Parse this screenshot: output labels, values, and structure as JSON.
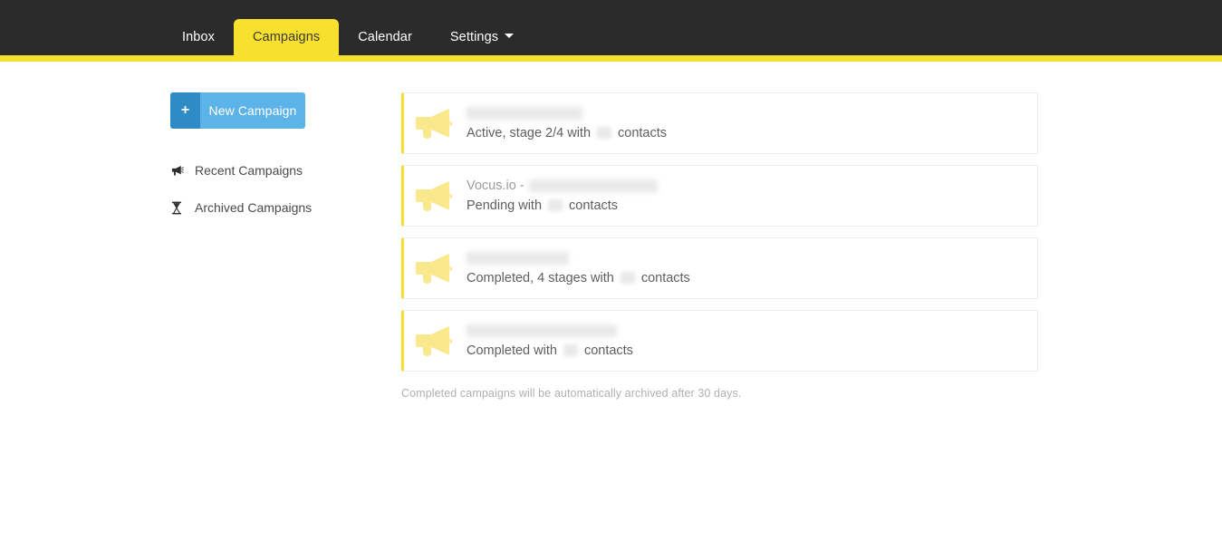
{
  "header": {
    "nav_items": [
      {
        "label": "Inbox",
        "active": false,
        "has_caret": false
      },
      {
        "label": "Campaigns",
        "active": true,
        "has_caret": false
      },
      {
        "label": "Calendar",
        "active": false,
        "has_caret": false
      },
      {
        "label": "Settings",
        "active": false,
        "has_caret": true
      }
    ],
    "accent_color": "#f5e02e",
    "background_color": "#2b2b2b"
  },
  "sidebar": {
    "new_campaign": {
      "plus_label": "+",
      "label": "New Campaign",
      "plus_color": "#2e8bc6",
      "button_color": "#5cb3e8"
    },
    "links": [
      {
        "label": "Recent Campaigns",
        "icon": "megaphone-icon"
      },
      {
        "label": "Archived Campaigns",
        "icon": "hourglass-icon"
      }
    ]
  },
  "main": {
    "campaigns": [
      {
        "icon": "megaphone-icon",
        "title_prefix": "",
        "title_redacted_width": 128,
        "status_before": "Active, stage 2/4 with",
        "status_after": "contacts",
        "stripe_color": "#f5e02e"
      },
      {
        "icon": "megaphone-icon",
        "title_prefix": "Vocus.io -",
        "title_redacted_width": 142,
        "status_before": "Pending with",
        "status_after": "contacts",
        "stripe_color": "#f5e02e"
      },
      {
        "icon": "megaphone-icon",
        "title_prefix": "",
        "title_redacted_width": 113,
        "status_before": "Completed, 4 stages with",
        "status_after": "contacts",
        "stripe_color": "#f5e02e"
      },
      {
        "icon": "megaphone-icon",
        "title_prefix": "",
        "title_redacted_width": 166,
        "status_before": "Completed with",
        "status_after": "contacts",
        "stripe_color": "#f5e02e"
      }
    ],
    "footnote": "Completed campaigns will be automatically archived after 30 days."
  }
}
